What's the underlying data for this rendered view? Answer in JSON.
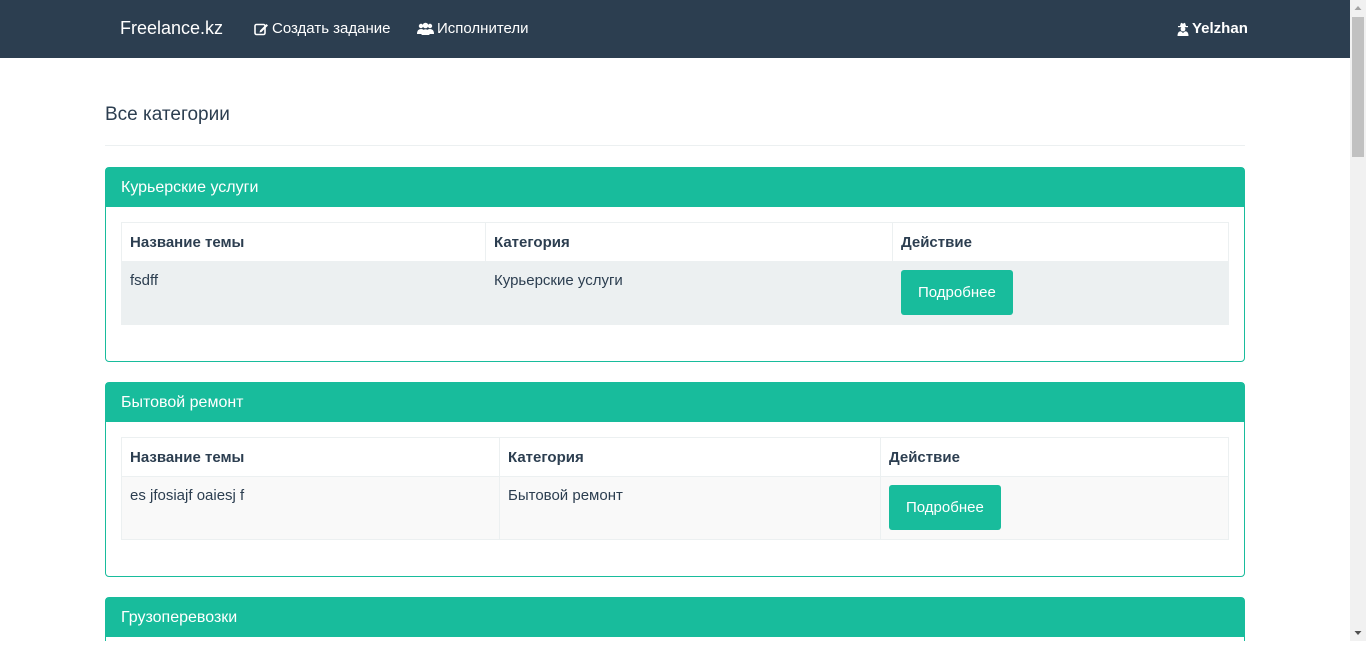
{
  "navbar": {
    "brand": "Freelance.kz",
    "create_task": "Создать задание",
    "performers": "Исполнители",
    "user": "Yelzhan",
    "icons": {
      "create": "edit-icon",
      "performers": "users-icon",
      "user": "user-secret-icon"
    }
  },
  "page": {
    "title": "Все категории"
  },
  "panels": [
    {
      "heading": "Курьерские услуги",
      "columns": [
        "Название темы",
        "Категория",
        "Действие"
      ],
      "rows": [
        {
          "topic": "fsdff",
          "category": "Курьерские услуги",
          "action": "Подробнее"
        }
      ]
    },
    {
      "heading": "Бытовой ремонт",
      "columns": [
        "Название темы",
        "Категория",
        "Действие"
      ],
      "rows": [
        {
          "topic": "es jfosiajf oaiesj f",
          "category": "Бытовой ремонт",
          "action": "Подробнее"
        }
      ]
    },
    {
      "heading": "Грузоперевозки"
    }
  ],
  "colors": {
    "navbar": "#2c3e50",
    "accent": "#18bc9c",
    "text": "#2c3e50",
    "row_striped": "#ecf0f1"
  }
}
